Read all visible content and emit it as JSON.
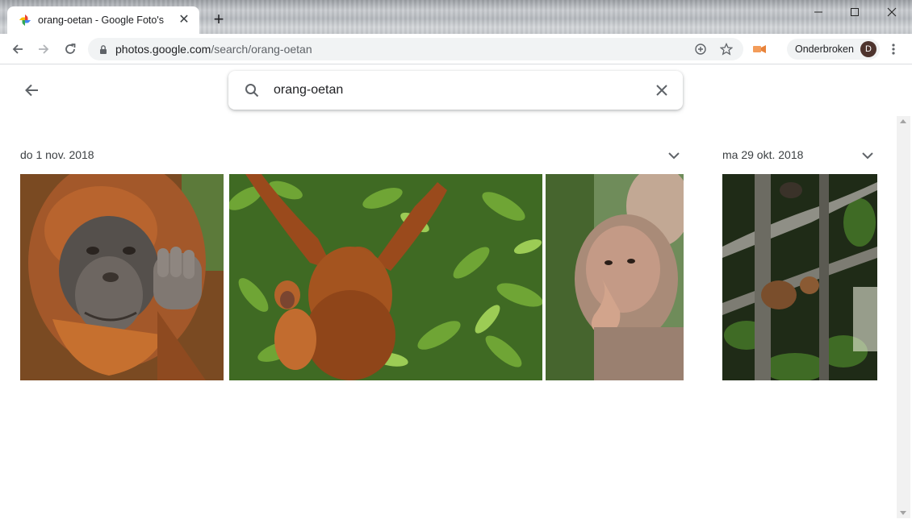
{
  "browser": {
    "tab": {
      "title": "orang-oetan - Google Foto's",
      "close": "✕"
    },
    "new_tab": "+",
    "address": {
      "host": "photos.google.com",
      "path": "/search/orang-oetan"
    },
    "profile": {
      "label": "Onderbroken",
      "initial": "D"
    }
  },
  "search": {
    "query": "orang-oetan"
  },
  "groups": [
    {
      "date": "do 1 nov. 2018"
    },
    {
      "date": "ma 29 okt. 2018"
    }
  ],
  "photos": [
    {
      "subject": "orangutan-portrait"
    },
    {
      "subject": "orangutan-mother-and-baby"
    },
    {
      "subject": "proboscis-monkey"
    },
    {
      "subject": "monkey-in-tree"
    }
  ],
  "colors": {
    "accent": "#1a73e8",
    "text": "#202124",
    "secondary_text": "#5f6368",
    "avatar": "#4e342e"
  }
}
